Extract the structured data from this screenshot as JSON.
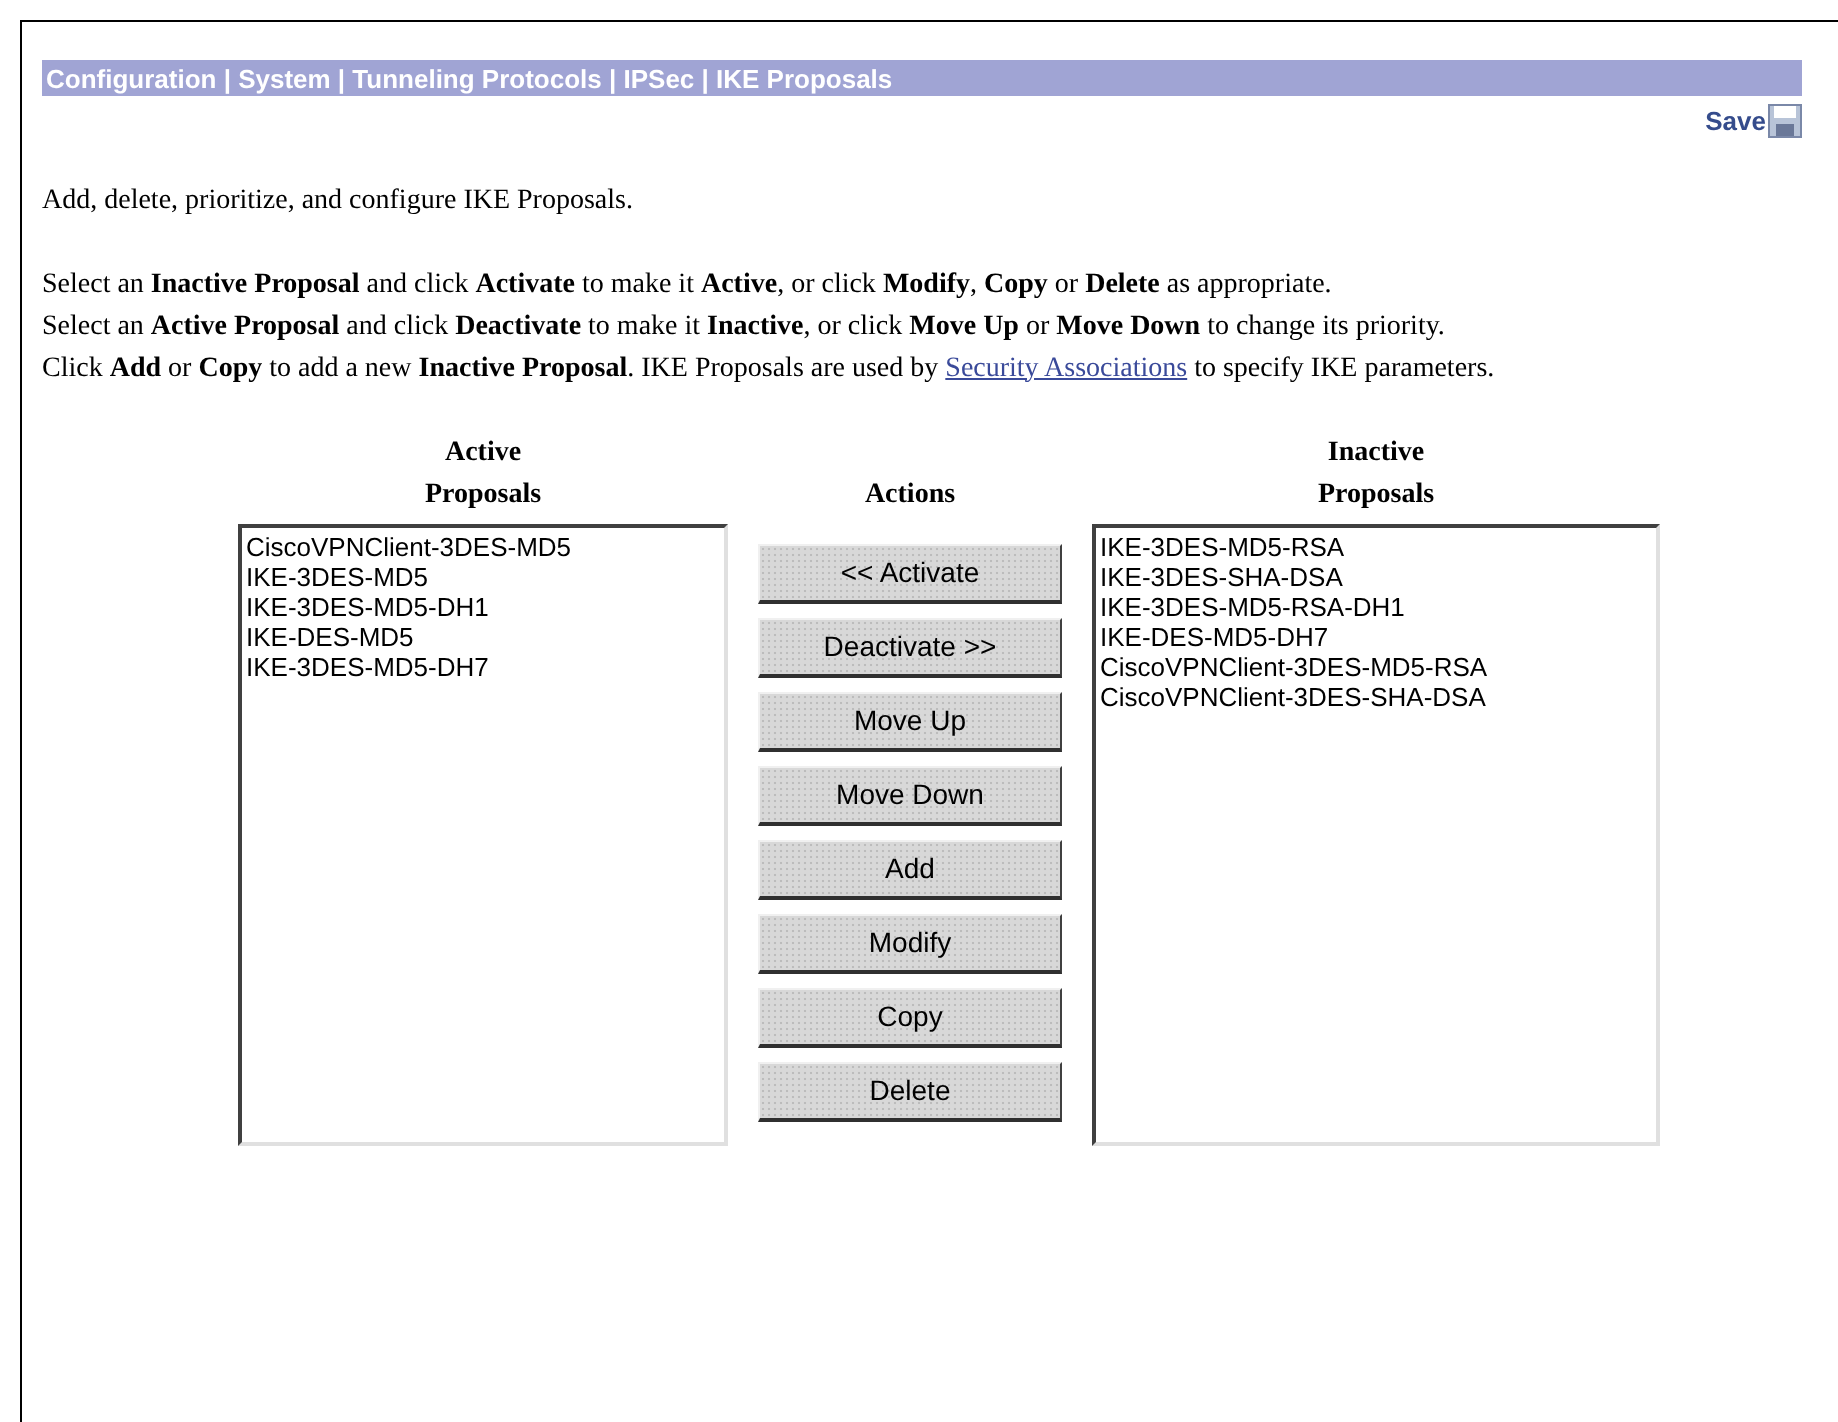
{
  "breadcrumb": "Configuration | System | Tunneling Protocols | IPSec | IKE Proposals",
  "save": "Save",
  "intro": "Add, delete, prioritize, and configure IKE Proposals.",
  "instructions": [
    "Select an **Inactive Proposal** and click **Activate** to make it **Active**, or click **Modify**, **Copy** or **Delete** as appropriate.",
    "Select an **Active Proposal** and click **Deactivate** to make it **Inactive**, or click **Move Up** or **Move Down** to change its priority."
  ],
  "note": {
    "before": "Click **Add** or **Copy** to add a new **Inactive Proposal**. IKE Proposals are used by ",
    "link": "Security Associations",
    "after": " to specify IKE parameters."
  },
  "active": {
    "heading": [
      "Active",
      "Proposals"
    ],
    "items": [
      "CiscoVPNClient-3DES-MD5",
      "IKE-3DES-MD5",
      "IKE-3DES-MD5-DH1",
      "IKE-DES-MD5",
      "IKE-3DES-MD5-DH7"
    ]
  },
  "actions": {
    "heading": "Actions",
    "buttons": [
      "<< Activate",
      "Deactivate >>",
      "Move Up",
      "Move Down",
      "Add",
      "Modify",
      "Copy",
      "Delete"
    ]
  },
  "inactive": {
    "heading": [
      "Inactive",
      "Proposals"
    ],
    "items": [
      "IKE-3DES-MD5-RSA",
      "IKE-3DES-SHA-DSA",
      "IKE-3DES-MD5-RSA-DH1",
      "IKE-DES-MD5-DH7",
      "CiscoVPNClient-3DES-MD5-RSA",
      "CiscoVPNClient-3DES-SHA-DSA"
    ]
  }
}
